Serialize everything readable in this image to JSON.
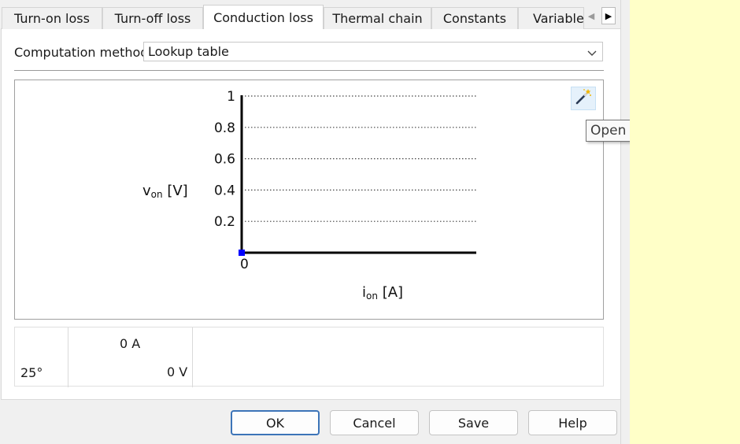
{
  "tabs": [
    {
      "label": "Turn-on loss",
      "active": false
    },
    {
      "label": "Turn-off loss",
      "active": false
    },
    {
      "label": "Conduction loss",
      "active": true
    },
    {
      "label": "Thermal chain",
      "active": false
    },
    {
      "label": "Constants",
      "active": false
    },
    {
      "label": "Variables",
      "active": false
    }
  ],
  "method": {
    "label": "Computation method:",
    "value": "Lookup table"
  },
  "tooltip": "Open import wizard",
  "chart_data": {
    "type": "line",
    "xlabel": {
      "var": "i",
      "sub": "on",
      "unit": " [A]"
    },
    "ylabel": {
      "var": "v",
      "sub": "on",
      "unit": " [V]"
    },
    "ylim": [
      0,
      1
    ],
    "yticks": [
      "0.2",
      "0.4",
      "0.6",
      "0.8",
      "1"
    ],
    "origin_label": "0",
    "grid": "horizontal-dotted",
    "series": [
      {
        "x": [
          0
        ],
        "y": [
          0
        ]
      }
    ]
  },
  "table": {
    "temperature": "25°",
    "current": "0 A",
    "voltage": "0 V"
  },
  "buttons": {
    "ok": "OK",
    "cancel": "Cancel",
    "save": "Save",
    "help": "Help"
  },
  "colors": {
    "accent": "#3c74b8",
    "marker": "#0000ff",
    "tooltip_bg": "#f9f9f9",
    "background": "#ffffc8"
  }
}
